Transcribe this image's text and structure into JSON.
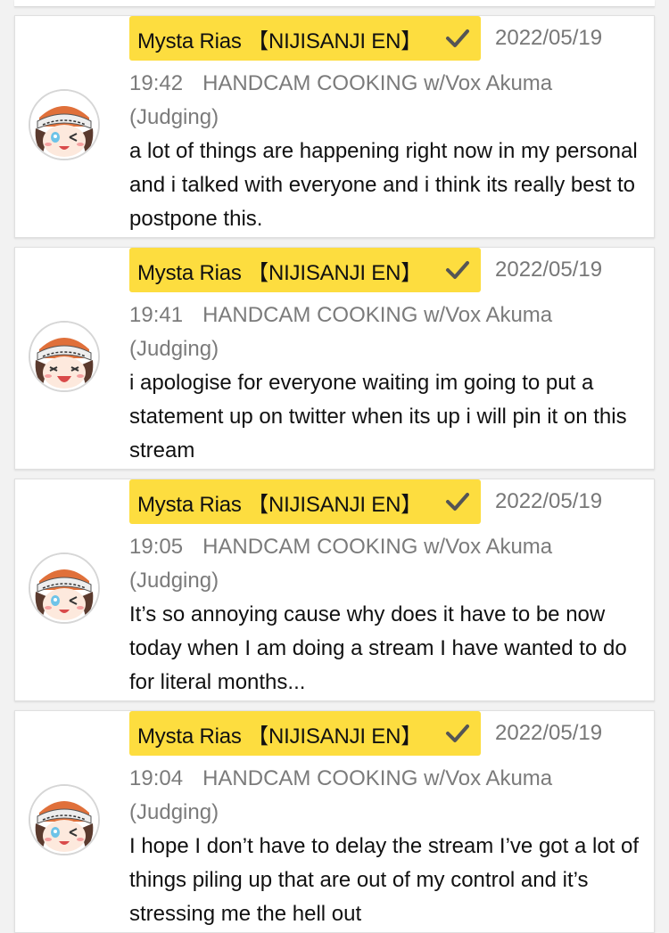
{
  "comments": [
    {
      "author": "Mysta Rias 【NIJISANJI EN】",
      "date": "2022/05/19",
      "time": "19:42",
      "stream": "HANDCAM COOKING w/Vox Akuma (Judging)",
      "text": "a lot of things are happening right now in my personal and i talked with everyone and i think its really best to postpone this."
    },
    {
      "author": "Mysta Rias 【NIJISANJI EN】",
      "date": "2022/05/19",
      "time": "19:41",
      "stream": "HANDCAM COOKING w/Vox Akuma (Judging)",
      "text": "i apologise for everyone waiting im going to put a statement up on twitter when its up i will pin it on this stream"
    },
    {
      "author": "Mysta Rias 【NIJISANJI EN】",
      "date": "2022/05/19",
      "time": "19:05",
      "stream": "HANDCAM COOKING w/Vox Akuma (Judging)",
      "text": "It’s so annoying cause why does it have to be now today when I am doing a stream I have wanted to do for literal months..."
    },
    {
      "author": "Mysta Rias 【NIJISANJI EN】",
      "date": "2022/05/19",
      "time": "19:04",
      "stream": "HANDCAM COOKING w/Vox Akuma (Judging)",
      "text": "I hope I don’t have to delay the stream I’ve got a lot of things piling up that are out of my control and it’s stressing me the hell out"
    }
  ],
  "icons": {
    "verified": "check-icon",
    "avatar": "avatar-image"
  },
  "colors": {
    "badge": "#fddd3f",
    "background": "#f2f2f2",
    "meta_text": "#7b7b7b"
  }
}
